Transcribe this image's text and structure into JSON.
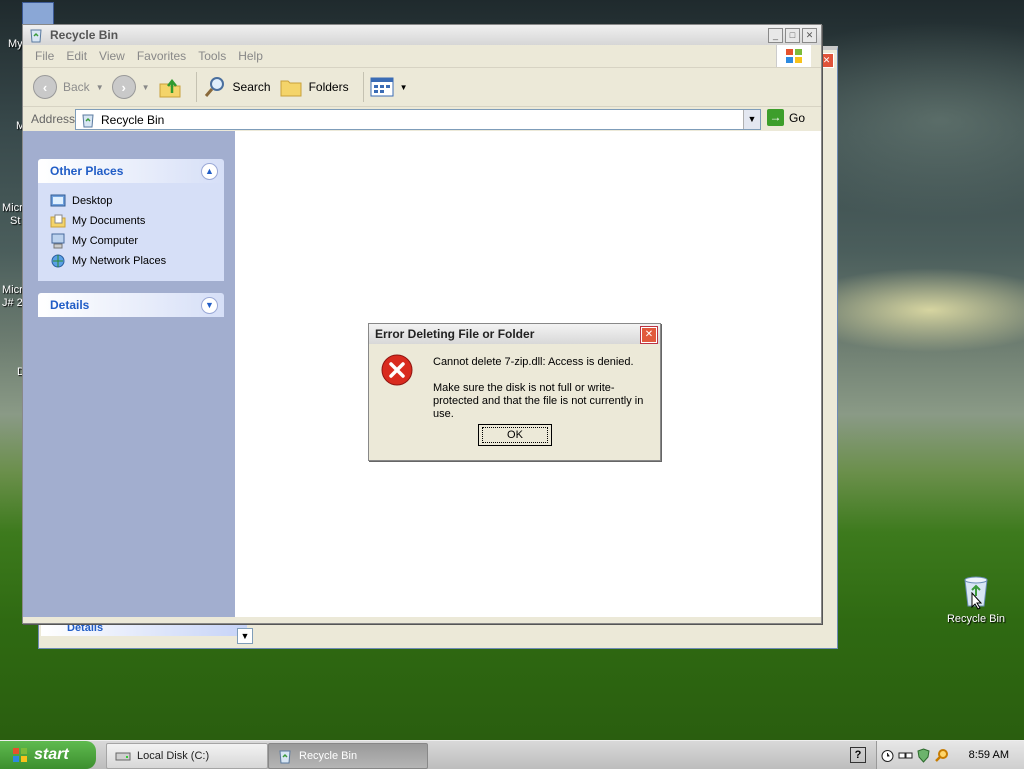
{
  "desktop": {
    "partial_labels": [
      "My",
      "M",
      "Micr",
      "St",
      "Micr",
      "J# 2",
      "D"
    ],
    "recycle_bin_label": "Recycle Bin"
  },
  "window": {
    "title": "Recycle Bin",
    "menu": [
      "File",
      "Edit",
      "View",
      "Favorites",
      "Tools",
      "Help"
    ],
    "toolbar": {
      "back_label": "Back",
      "search_label": "Search",
      "folders_label": "Folders"
    },
    "address": {
      "label": "Address",
      "value": "Recycle Bin",
      "go_label": "Go"
    },
    "other_places": {
      "title": "Other Places",
      "items": [
        "Desktop",
        "My Documents",
        "My Computer",
        "My Network Places"
      ]
    },
    "details_title": "Details"
  },
  "background_window": {
    "details_title": "Details"
  },
  "dialog": {
    "title": "Error Deleting File or Folder",
    "message1": "Cannot delete 7-zip.dll: Access is denied.",
    "message2": "Make sure the disk is not full or write-protected and that the file is not currently in use.",
    "ok_label": "OK"
  },
  "taskbar": {
    "start_label": "start",
    "tasks": [
      "Local Disk (C:)",
      "Recycle Bin"
    ],
    "clock": "8:59 AM"
  },
  "colors": {
    "link_blue": "#215dc6",
    "task_pane": "#a2aecf",
    "error_red": "#d92b1f",
    "start_green": "#3c8f2e"
  }
}
